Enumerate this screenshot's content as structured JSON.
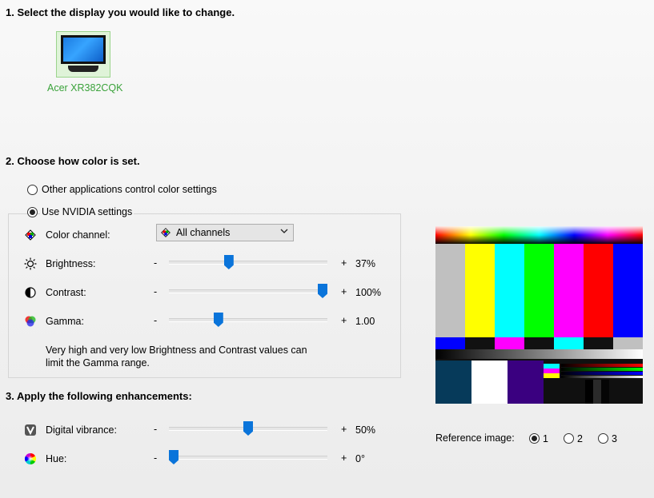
{
  "section1": {
    "heading": "1. Select the display you would like to change."
  },
  "display": {
    "name": "Acer XR382CQK",
    "icon": "monitor-icon"
  },
  "section2": {
    "heading": "2. Choose how color is set.",
    "option_other": "Other applications control color settings",
    "option_nvidia": "Use NVIDIA settings",
    "selected": "nvidia"
  },
  "color": {
    "channel_label": "Color channel:",
    "channel_value": "All channels",
    "brightness": {
      "label": "Brightness:",
      "value": "37%",
      "level": 0.37
    },
    "contrast": {
      "label": "Contrast:",
      "value": "100%",
      "level": 1.0
    },
    "gamma": {
      "label": "Gamma:",
      "value": "1.00",
      "level": 0.3
    },
    "note": "Very high and very low Brightness and Contrast values can limit the Gamma range."
  },
  "section3": {
    "heading": "3. Apply the following enhancements:",
    "vibrance": {
      "label": "Digital vibrance:",
      "value": "50%",
      "level": 0.5
    },
    "hue": {
      "label": "Hue:",
      "value": "0°",
      "level": 0.0
    }
  },
  "reference": {
    "label": "Reference image:",
    "options": [
      "1",
      "2",
      "3"
    ],
    "selected": "1"
  },
  "symbols": {
    "minus": "-",
    "plus": "+"
  },
  "colors": {
    "accent": "#0a74da",
    "display_name": "#3aa23a"
  }
}
